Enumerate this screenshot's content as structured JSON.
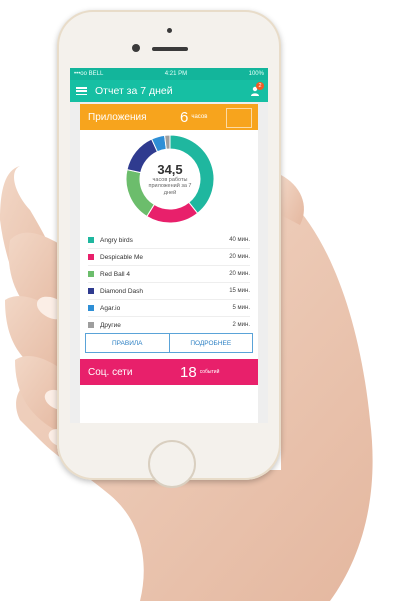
{
  "statusbar": {
    "carrier": "•••oo BELL",
    "time": "4:21 PM",
    "battery": "100%"
  },
  "appbar": {
    "title": "Отчет за 7 дней",
    "notification_count": "2"
  },
  "apps_section": {
    "title": "Приложения",
    "count": "6",
    "unit": "часов"
  },
  "donut": {
    "value": "34,5",
    "label": "часов работы приложений за 7 дней"
  },
  "chart_data": {
    "type": "pie",
    "categories": [
      "Angry birds",
      "Despicable Me",
      "Red Ball 4",
      "Diamond Dash",
      "Agar.io",
      "Другие"
    ],
    "values": [
      40,
      20,
      20,
      15,
      5,
      2
    ],
    "colors": [
      "#1fb79f",
      "#e8206b",
      "#6cbd6c",
      "#2f3b8f",
      "#2e8fd6",
      "#9e9e9e"
    ]
  },
  "app_list": [
    {
      "name": "Angry birds",
      "value": "40 мин.",
      "color": "#1fb79f"
    },
    {
      "name": "Despicable Me",
      "value": "20 мин.",
      "color": "#e8206b"
    },
    {
      "name": "Red Ball 4",
      "value": "20 мин.",
      "color": "#6cbd6c"
    },
    {
      "name": "Diamond Dash",
      "value": "15 мин.",
      "color": "#2f3b8f"
    },
    {
      "name": "Agar.io",
      "value": "5 мин.",
      "color": "#2e8fd6"
    },
    {
      "name": "Другие",
      "value": "2 мин.",
      "color": "#9e9e9e"
    }
  ],
  "buttons": {
    "rules": "ПРАВИЛА",
    "details": "ПОДРОБНЕЕ"
  },
  "social_section": {
    "title": "Соц. сети",
    "count": "18",
    "unit": "событий"
  }
}
